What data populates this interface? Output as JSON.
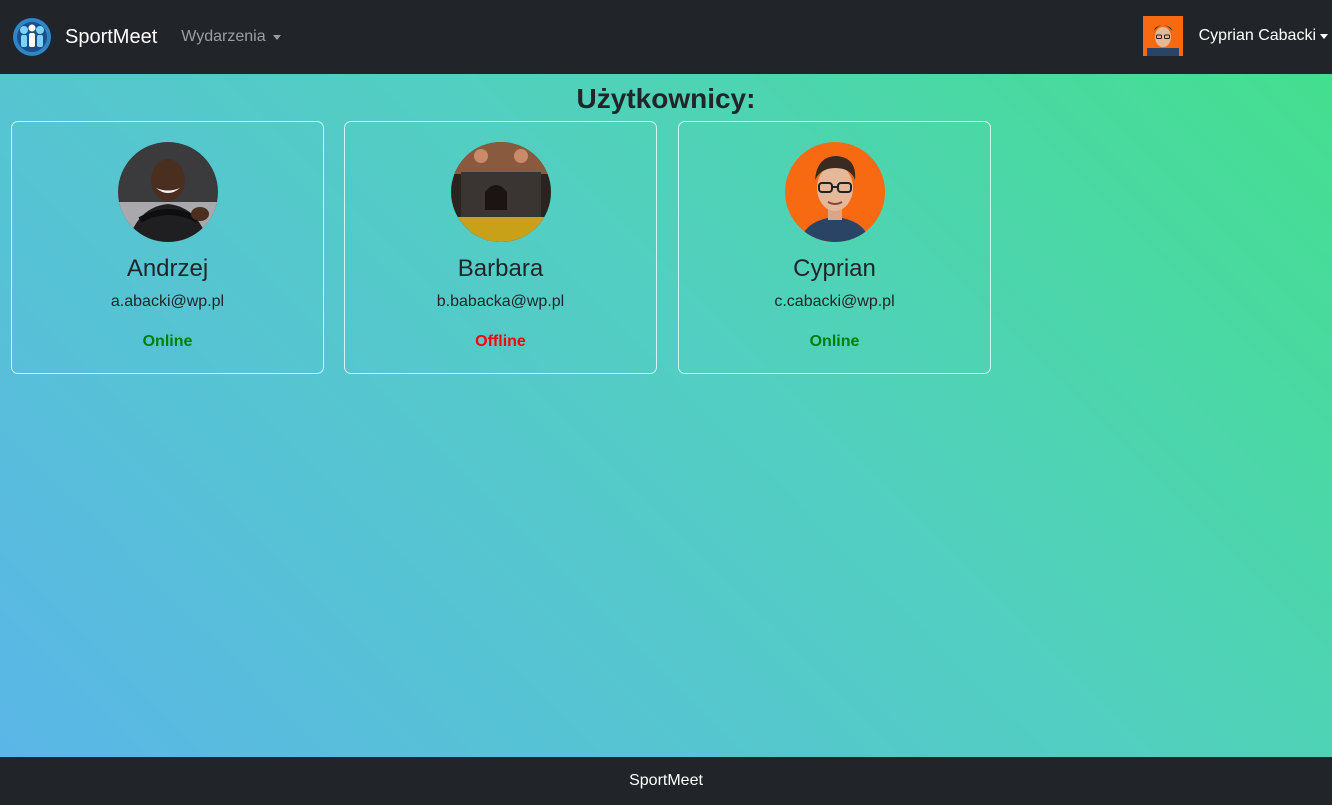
{
  "navbar": {
    "brand_name": "SportMeet",
    "events_menu_label": "Wydarzenia",
    "user_name": "Cyprian Cabacki"
  },
  "page": {
    "title": "Użytkownicy:"
  },
  "users": [
    {
      "name": "Andrzej",
      "email": "a.abacki@wp.pl",
      "status": "Online",
      "status_color": "#008000"
    },
    {
      "name": "Barbara",
      "email": "b.babacka@wp.pl",
      "status": "Offline",
      "status_color": "#ff0000"
    },
    {
      "name": "Cyprian",
      "email": "c.cabacki@wp.pl",
      "status": "Online",
      "status_color": "#008000"
    }
  ],
  "footer": {
    "text": "SportMeet"
  },
  "colors": {
    "navbar_bg": "#212529",
    "gradient_start": "#43e08a",
    "gradient_end": "#5bb5e9"
  }
}
